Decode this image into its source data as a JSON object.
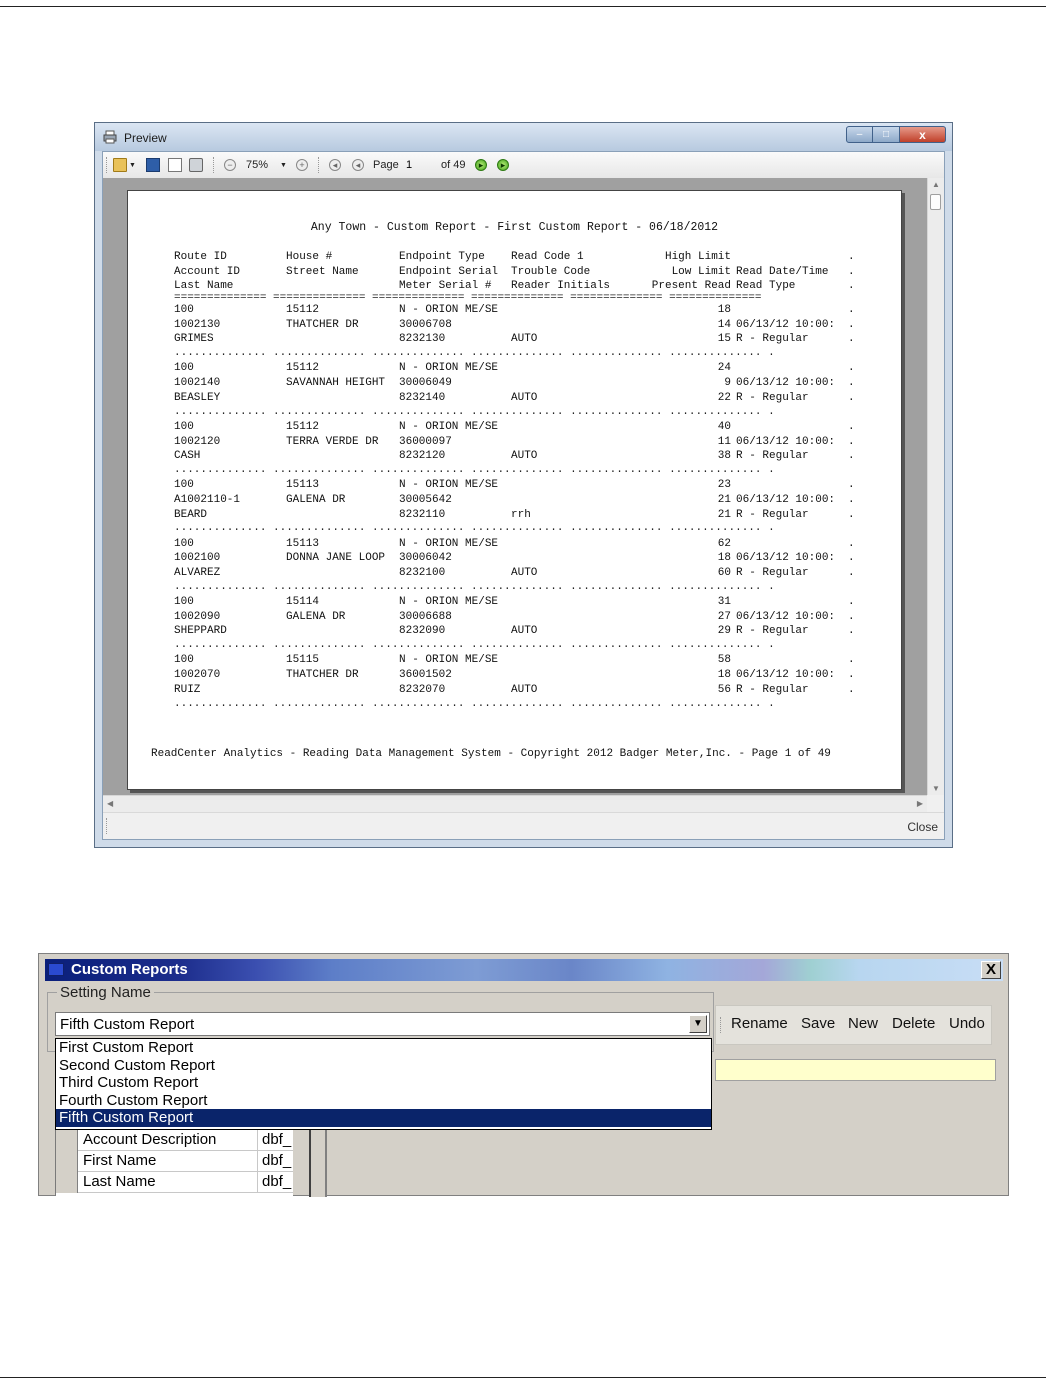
{
  "preview": {
    "title": "Preview",
    "window_buttons": {
      "minimize": "–",
      "maximize": "□",
      "close": "x"
    },
    "toolbar": {
      "zoom": "75%",
      "page_label": "Page",
      "page_value": "1",
      "of_label": "of 49"
    },
    "close_label": "Close",
    "report": {
      "title": "Any Town - Custom Report - First Custom Report - 06/18/2012",
      "headers": [
        [
          "Route ID",
          "House #",
          "Endpoint Type",
          "Read Code 1",
          "High Limit",
          "",
          "."
        ],
        [
          "Account ID",
          "Street Name",
          "Endpoint Serial",
          "Trouble Code",
          "Low Limit",
          "Read Date/Time",
          "."
        ],
        [
          "Last Name",
          "",
          "Meter Serial #",
          "Reader Initials",
          "Present Read",
          "Read Type",
          "."
        ]
      ],
      "header_rule": "============== ============== ============== ============== ============== ==============",
      "dot_rule": ".............. .............. .............. .............. .............. .............. .",
      "records": [
        [
          [
            "100",
            "15112",
            "N - ORION ME/SE",
            "",
            "18",
            "",
            "."
          ],
          [
            "1002130",
            "THATCHER DR",
            "30006708",
            "",
            "14",
            "06/13/12 10:00:",
            "."
          ],
          [
            "GRIMES",
            "",
            "8232130",
            "AUTO",
            "15",
            "R - Regular",
            "."
          ]
        ],
        [
          [
            "100",
            "15112",
            "N - ORION ME/SE",
            "",
            "24",
            "",
            "."
          ],
          [
            "1002140",
            "SAVANNAH HEIGHT",
            "30006049",
            "",
            "9",
            "06/13/12 10:00:",
            "."
          ],
          [
            "BEASLEY",
            "",
            "8232140",
            "AUTO",
            "22",
            "R - Regular",
            "."
          ]
        ],
        [
          [
            "100",
            "15112",
            "N - ORION ME/SE",
            "",
            "40",
            "",
            "."
          ],
          [
            "1002120",
            "TERRA VERDE DR",
            "36000097",
            "",
            "11",
            "06/13/12 10:00:",
            "."
          ],
          [
            "CASH",
            "",
            "8232120",
            "AUTO",
            "38",
            "R - Regular",
            "."
          ]
        ],
        [
          [
            "100",
            "15113",
            "N - ORION ME/SE",
            "",
            "23",
            "",
            "."
          ],
          [
            "A1002110-1",
            "GALENA DR",
            "30005642",
            "",
            "21",
            "06/13/12 10:00:",
            "."
          ],
          [
            "BEARD",
            "",
            "8232110",
            "rrh",
            "21",
            "R - Regular",
            "."
          ]
        ],
        [
          [
            "100",
            "15113",
            "N - ORION ME/SE",
            "",
            "62",
            "",
            "."
          ],
          [
            "1002100",
            "DONNA JANE LOOP",
            "30006042",
            "",
            "18",
            "06/13/12 10:00:",
            "."
          ],
          [
            "ALVAREZ",
            "",
            "8232100",
            "AUTO",
            "60",
            "R - Regular",
            "."
          ]
        ],
        [
          [
            "100",
            "15114",
            "N - ORION ME/SE",
            "",
            "31",
            "",
            "."
          ],
          [
            "1002090",
            "GALENA DR",
            "30006688",
            "",
            "27",
            "06/13/12 10:00:",
            "."
          ],
          [
            "SHEPPARD",
            "",
            "8232090",
            "AUTO",
            "29",
            "R - Regular",
            "."
          ]
        ],
        [
          [
            "100",
            "15115",
            "N - ORION ME/SE",
            "",
            "58",
            "",
            "."
          ],
          [
            "1002070",
            "THATCHER DR",
            "36001502",
            "",
            "18",
            "06/13/12 10:00:",
            "."
          ],
          [
            "RUIZ",
            "",
            "8232070",
            "AUTO",
            "56",
            "R - Regular",
            "."
          ]
        ]
      ],
      "footer": "ReadCenter Analytics - Reading Data Management System - Copyright 2012 Badger Meter,Inc. - Page 1 of 49"
    }
  },
  "custom_reports": {
    "title": "Custom Reports",
    "close_glyph": "X",
    "setting_name_label": "Setting Name",
    "selected": "Fifth Custom Report",
    "options": [
      "First Custom Report",
      "Second Custom Report",
      "Third Custom Report",
      "Fourth Custom Report",
      "Fifth Custom Report"
    ],
    "buttons": {
      "rename": "Rename",
      "save": "Save",
      "new": "New",
      "delete": "Delete",
      "undo": "Undo"
    },
    "fields": [
      {
        "name": "Account Description",
        "source": "dbf_"
      },
      {
        "name": "First Name",
        "source": "dbf_"
      },
      {
        "name": "Last Name",
        "source": "dbf_"
      }
    ]
  }
}
